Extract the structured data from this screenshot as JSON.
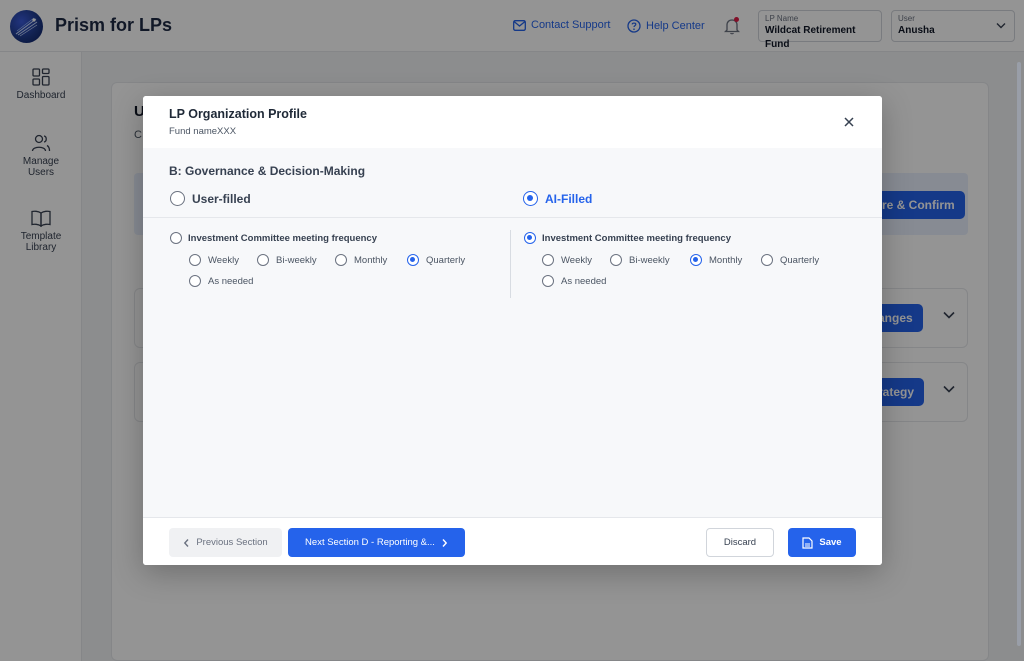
{
  "app": {
    "title": "Prism for LPs"
  },
  "header": {
    "contact_support": "Contact Support",
    "help_center": "Help Center",
    "lp_name_label": "LP Name",
    "lp_name_value": "Wildcat Retirement Fund",
    "user_label": "User",
    "user_value": "Anusha"
  },
  "sidebar": {
    "items": [
      {
        "label": "Dashboard",
        "icon": "grid-icon"
      },
      {
        "label": "Manage Users",
        "icon": "users-icon"
      },
      {
        "label": "Template Library",
        "icon": "book-icon"
      }
    ]
  },
  "background": {
    "title_initial": "U",
    "subtitle_initial": "C",
    "confirm_button": "re & Confirm",
    "changes_button": "anges",
    "strategy_button": "rategy"
  },
  "modal": {
    "title": "LP Organization Profile",
    "subtitle": "Fund nameXXX",
    "section_title": "B: Governance & Decision-Making",
    "source_user": "User-filled",
    "source_ai": "AI-Filled",
    "selected_source": "AI-Filled",
    "left": {
      "question": "Investment Committee meeting frequency",
      "options": [
        "Weekly",
        "Bi-weekly",
        "Monthly",
        "Quarterly",
        "As needed"
      ],
      "selected": "Quarterly",
      "question_selected": false
    },
    "right": {
      "question": "Investment Committee meeting frequency",
      "options": [
        "Weekly",
        "Bi-weekly",
        "Monthly",
        "Quarterly",
        "As needed"
      ],
      "selected": "Monthly",
      "question_selected": true
    },
    "footer": {
      "previous": "Previous Section",
      "next": "Next Section D - Reporting &...",
      "discard": "Discard",
      "save": "Save"
    }
  },
  "colors": {
    "accent": "#2563eb",
    "overlay": "rgba(0,0,0,0.42)",
    "notification_dot": "#e11d48"
  }
}
